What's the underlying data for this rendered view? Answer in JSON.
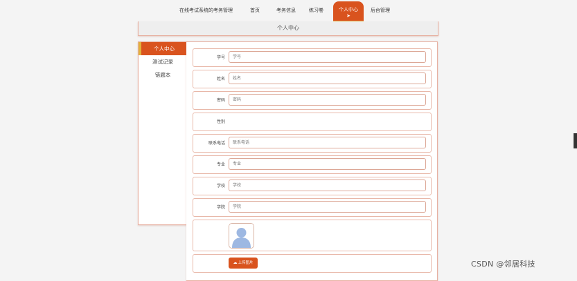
{
  "nav": {
    "site_title": "在线考试系统的考务管理",
    "items": [
      {
        "label": "首页"
      },
      {
        "label": "考务信息"
      },
      {
        "label": "练习卷"
      },
      {
        "label": "个人中心"
      },
      {
        "label": "后台管理"
      }
    ],
    "active_index": 3
  },
  "page_title": "个人中心",
  "sidebar": {
    "items": [
      {
        "label": "个人中心"
      },
      {
        "label": "测试记录"
      },
      {
        "label": "错题本"
      }
    ],
    "active_index": 0
  },
  "form": {
    "fields": [
      {
        "label": "学号",
        "placeholder": "学号"
      },
      {
        "label": "姓名",
        "placeholder": "姓名"
      },
      {
        "label": "密码",
        "placeholder": "密码"
      },
      {
        "label": "性别"
      },
      {
        "label": "联系电话",
        "placeholder": "联系电话"
      },
      {
        "label": "专业",
        "placeholder": "专业"
      },
      {
        "label": "学校",
        "placeholder": "学校"
      },
      {
        "label": "学院",
        "placeholder": "学院"
      }
    ],
    "upload_label": "上传图片"
  },
  "watermark": "CSDN @邻居科技",
  "colors": {
    "accent": "#d9531e",
    "accent_underline": "#e2b13c",
    "border": "#e7b1a2",
    "avatar_blue": "#9db8e2"
  },
  "icons": {
    "avatar": "user-avatar-placeholder",
    "upload": "cloud-upload-icon"
  }
}
